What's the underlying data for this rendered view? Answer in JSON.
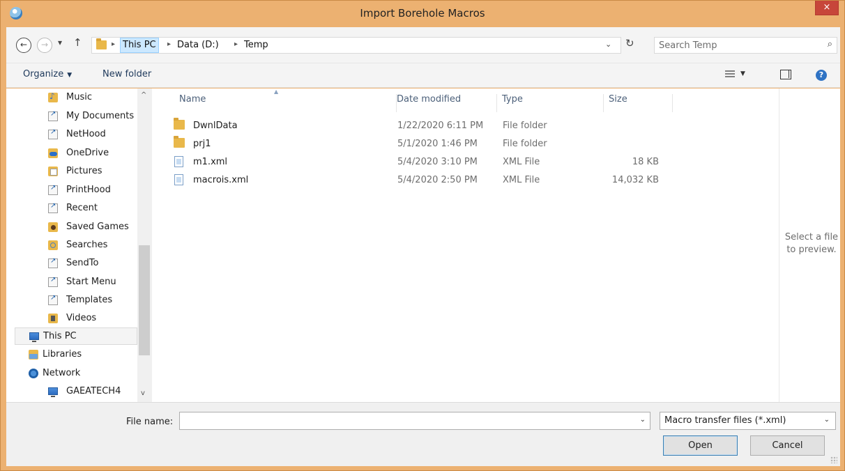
{
  "window": {
    "title": "Import Borehole Macros",
    "close_label": "×"
  },
  "navigation": {
    "back_glyph": "←",
    "forward_glyph": "→",
    "recent_glyph": "▾",
    "up_glyph": "↑"
  },
  "breadcrumb": {
    "items": [
      "This PC",
      "Data (D:)",
      "Temp"
    ],
    "separator": "▸",
    "dropdown_glyph": "⌄",
    "refresh_glyph": "↻"
  },
  "search": {
    "placeholder": "Search Temp",
    "icon_glyph": "⌕"
  },
  "toolbar": {
    "organize_label": "Organize",
    "caret": "▼",
    "new_folder_label": "New folder",
    "help_glyph": "?"
  },
  "sidebar": {
    "items": [
      {
        "label": "Music",
        "icon": "music-folder-icon"
      },
      {
        "label": "My Documents",
        "icon": "shortcut-icon"
      },
      {
        "label": "NetHood",
        "icon": "shortcut-icon"
      },
      {
        "label": "OneDrive",
        "icon": "onedrive-icon"
      },
      {
        "label": "Pictures",
        "icon": "pictures-folder-icon"
      },
      {
        "label": "PrintHood",
        "icon": "shortcut-icon"
      },
      {
        "label": "Recent",
        "icon": "shortcut-icon"
      },
      {
        "label": "Saved Games",
        "icon": "saved-games-icon"
      },
      {
        "label": "Searches",
        "icon": "searches-icon"
      },
      {
        "label": "SendTo",
        "icon": "shortcut-icon"
      },
      {
        "label": "Start Menu",
        "icon": "shortcut-icon"
      },
      {
        "label": "Templates",
        "icon": "shortcut-icon"
      },
      {
        "label": "Videos",
        "icon": "videos-folder-icon"
      },
      {
        "label": "This PC",
        "icon": "computer-icon"
      },
      {
        "label": "Libraries",
        "icon": "libraries-icon"
      },
      {
        "label": "Network",
        "icon": "network-icon"
      },
      {
        "label": "GAEATECH4",
        "icon": "computer-icon"
      }
    ],
    "selected": "This PC",
    "scroll_up_glyph": "^",
    "scroll_down_glyph": "v"
  },
  "file_list": {
    "columns": [
      "Name",
      "Date modified",
      "Type",
      "Size"
    ],
    "sort_glyph": "▲",
    "rows": [
      {
        "name": "DwnlData",
        "date": "1/22/2020 6:11 PM",
        "type": "File folder",
        "size": "",
        "icon": "folder-icon"
      },
      {
        "name": "prj1",
        "date": "5/1/2020 1:46 PM",
        "type": "File folder",
        "size": "",
        "icon": "folder-icon"
      },
      {
        "name": "m1.xml",
        "date": "5/4/2020 3:10 PM",
        "type": "XML File",
        "size": "18 KB",
        "icon": "xml-file-icon"
      },
      {
        "name": "macrois.xml",
        "date": "5/4/2020 2:50 PM",
        "type": "XML File",
        "size": "14,032 KB",
        "icon": "xml-file-icon"
      }
    ]
  },
  "preview": {
    "message": "Select a file to preview."
  },
  "footer": {
    "file_name_label": "File name:",
    "file_name_value": "",
    "filter_value": "Macro transfer files (*.xml)",
    "dropdown_glyph": "⌄",
    "open_label": "Open",
    "cancel_label": "Cancel"
  },
  "colors": {
    "frame": "#ecb171",
    "close_button": "#c7463a",
    "breadcrumb_active": "#cce8ff",
    "primary_button_border": "#3c7fb1"
  }
}
